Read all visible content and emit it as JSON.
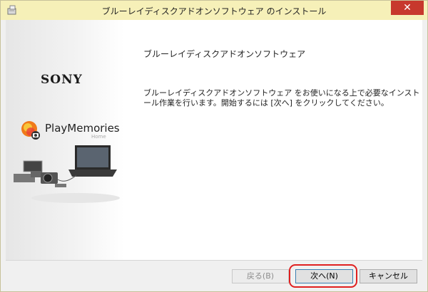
{
  "window": {
    "title": "ブルーレイディスクアドオンソフトウェア のインストール",
    "close_glyph": "✕"
  },
  "branding": {
    "sony_logo": "SONY",
    "product_name": "PlayMemories",
    "product_sub": "Home"
  },
  "main": {
    "heading": "ブルーレイディスクアドオンソフトウェア",
    "description": "ブルーレイディスクアドオンソフトウェア をお使いになる上で必要なインストール作業を行います。開始するには [次へ] をクリックしてください。"
  },
  "buttons": {
    "back": "戻る(B)",
    "next": "次へ(N)",
    "cancel": "キャンセル"
  },
  "colors": {
    "titlebar": "#f6f0b8",
    "close": "#c7382d",
    "highlight": "#e02020"
  }
}
